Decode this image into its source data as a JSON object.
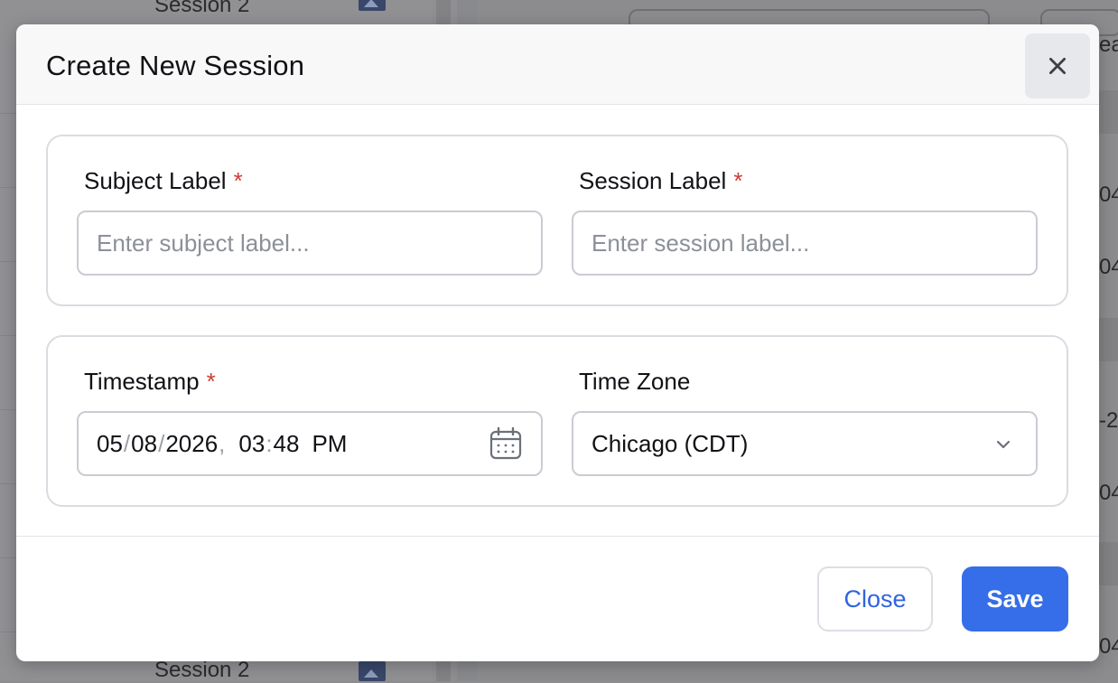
{
  "background": {
    "session_items": [
      "Session 2",
      "Session 2"
    ],
    "edge_fragments": [
      "eat",
      "04",
      "04",
      "-2",
      "04",
      "04"
    ]
  },
  "modal": {
    "title": "Create New Session",
    "close_icon": "close-icon",
    "subject_label": {
      "label": "Subject Label",
      "required_mark": "*",
      "placeholder": "Enter subject label...",
      "value": ""
    },
    "session_label": {
      "label": "Session Label",
      "required_mark": "*",
      "placeholder": "Enter session label...",
      "value": ""
    },
    "timestamp": {
      "label": "Timestamp",
      "required_mark": "*",
      "month": "05",
      "day": "08",
      "year": "2026",
      "date_sep": "/",
      "datetime_sep": ",",
      "hour": "03",
      "minute": "48",
      "time_sep": ":",
      "ampm": "PM",
      "icon": "calendar-icon"
    },
    "time_zone": {
      "label": "Time Zone",
      "selected": "Chicago (CDT)",
      "icon": "chevron-down-icon"
    },
    "footer": {
      "close_label": "Close",
      "save_label": "Save"
    }
  },
  "colors": {
    "primary": "#356ee8",
    "required": "#d03a34",
    "overlay": "#8f8f92"
  }
}
